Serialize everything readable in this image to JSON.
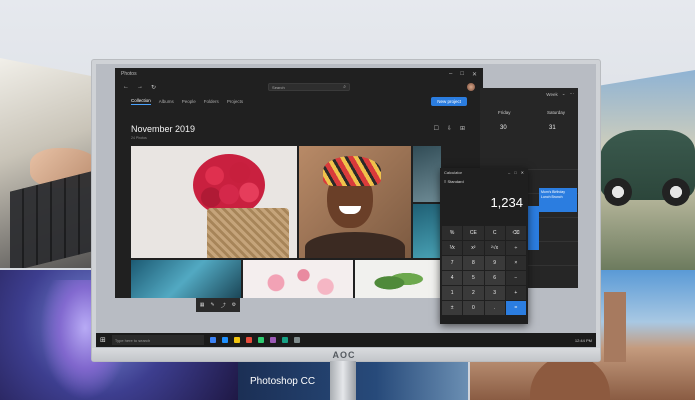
{
  "background": {
    "photoshop_label": "Photoshop CC"
  },
  "monitor": {
    "brand": "AOC"
  },
  "photos_window": {
    "app_name": "Photos",
    "search_placeholder": "Search",
    "tabs": [
      "Collection",
      "Albums",
      "People",
      "Folders",
      "Projects"
    ],
    "new_project_label": "New project",
    "heading": "November 2019",
    "item_count": "24 Photos"
  },
  "calendar_window": {
    "view_label": "Week",
    "days": [
      {
        "name": "Friday",
        "date": "30"
      },
      {
        "name": "Saturday",
        "date": "31"
      }
    ],
    "event_text": "Mom's Birthday Lunch Brunch"
  },
  "calculator": {
    "title": "Calculator",
    "mode": "Standard",
    "display": "1,234",
    "keys": [
      "%",
      "CE",
      "C",
      "⌫",
      "⅟x",
      "x²",
      "²√x",
      "÷",
      "7",
      "8",
      "9",
      "×",
      "4",
      "5",
      "6",
      "−",
      "1",
      "2",
      "3",
      "+",
      "±",
      "0",
      ".",
      "="
    ]
  },
  "taskbar": {
    "search_placeholder": "Type here to search",
    "tray_text": "12:44 PM"
  }
}
